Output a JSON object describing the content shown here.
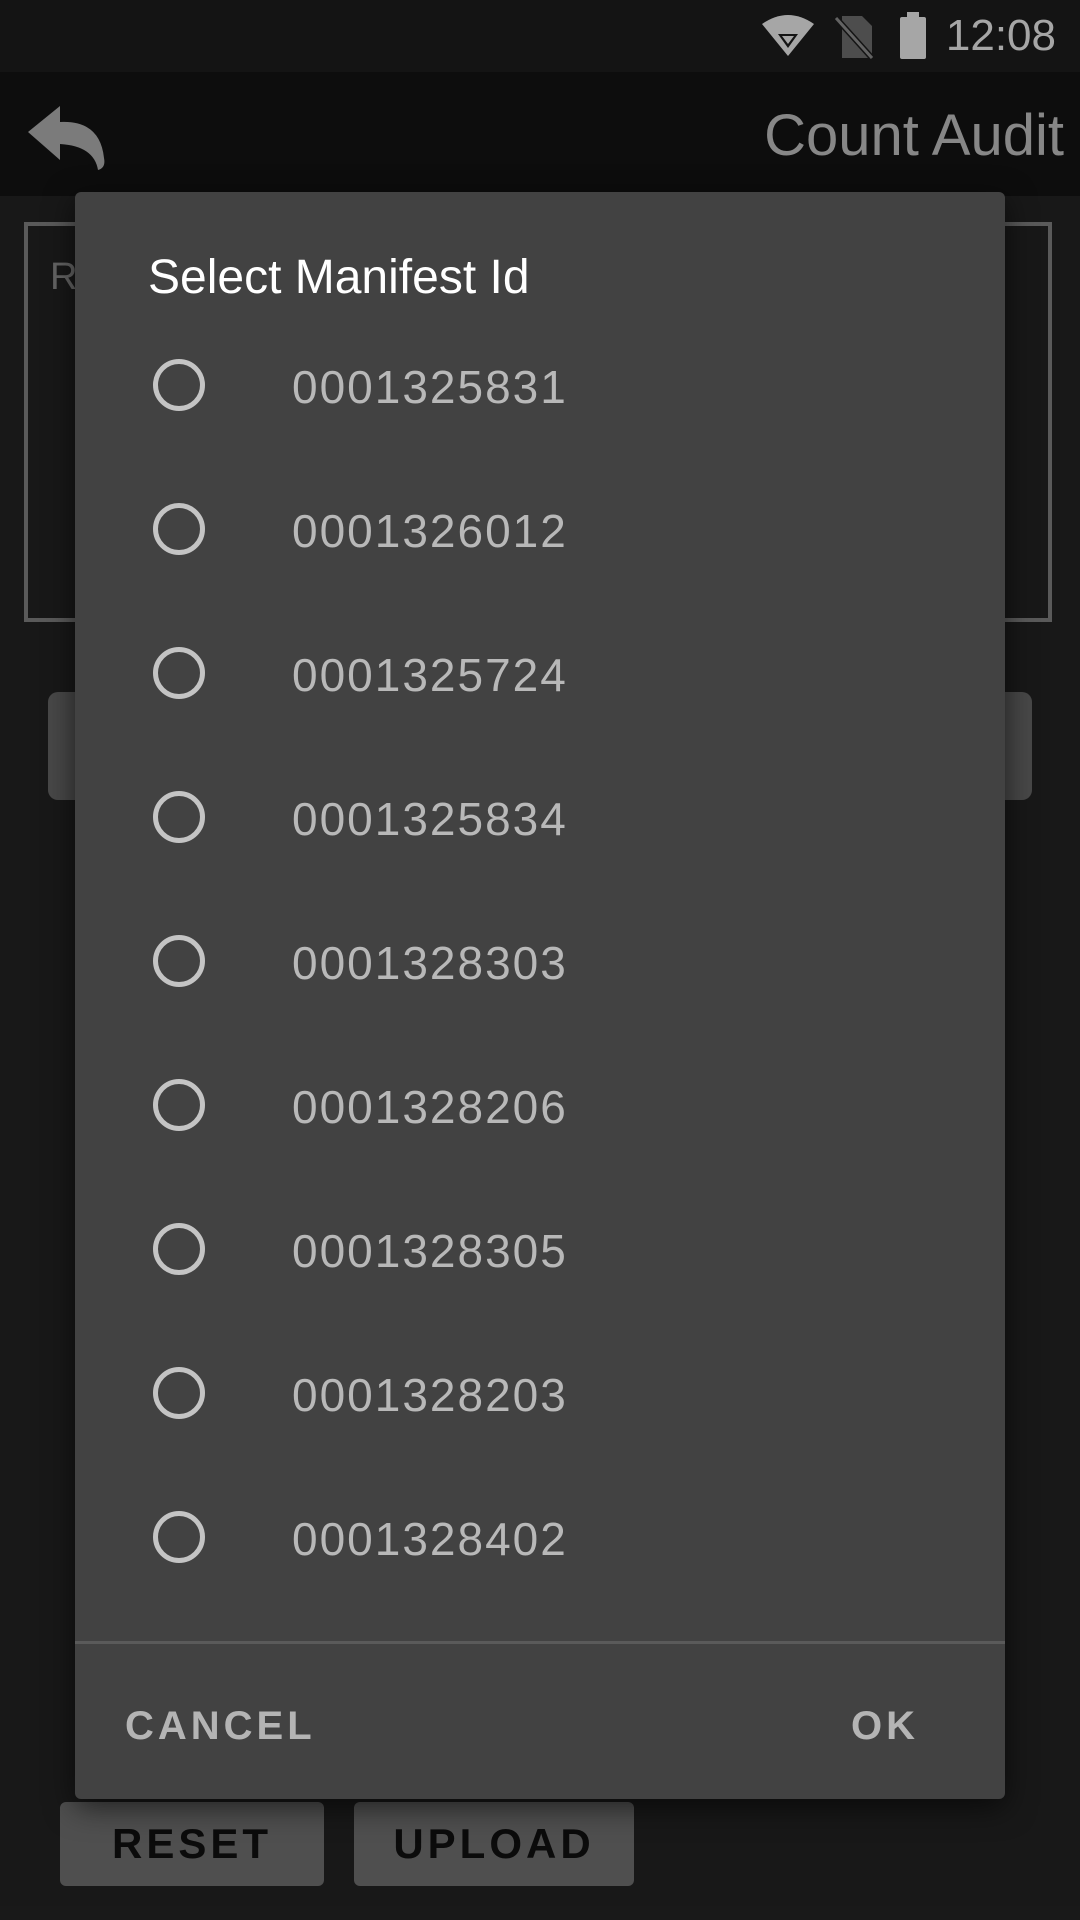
{
  "status_bar": {
    "time": "12:08"
  },
  "app_bar": {
    "title": "Count Audit"
  },
  "background": {
    "panel_label": "R",
    "reset_label": "RESET",
    "upload_label": "UPLOAD"
  },
  "dialog": {
    "title": "Select Manifest Id",
    "options": [
      {
        "label": "0001325831",
        "selected": false
      },
      {
        "label": "0001326012",
        "selected": false
      },
      {
        "label": "0001325724",
        "selected": false
      },
      {
        "label": "0001325834",
        "selected": false
      },
      {
        "label": "0001328303",
        "selected": false
      },
      {
        "label": "0001328206",
        "selected": false
      },
      {
        "label": "0001328305",
        "selected": false
      },
      {
        "label": "0001328203",
        "selected": false
      },
      {
        "label": "0001328402",
        "selected": false
      }
    ],
    "cancel_label": "CANCEL",
    "ok_label": "OK"
  }
}
